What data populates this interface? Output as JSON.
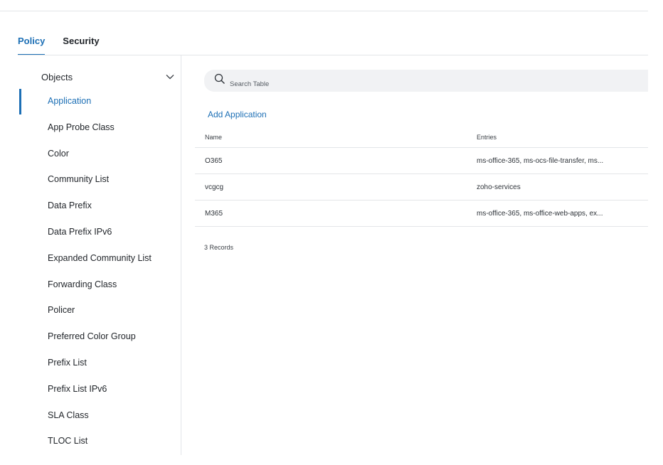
{
  "tabs": [
    {
      "label": "Policy",
      "active": true
    },
    {
      "label": "Security",
      "active": false
    }
  ],
  "sidebar": {
    "group_label": "Objects",
    "group_icon": "chevron-down-icon",
    "items": [
      {
        "label": "Application",
        "active": true
      },
      {
        "label": "App Probe Class"
      },
      {
        "label": "Color"
      },
      {
        "label": "Community List"
      },
      {
        "label": "Data Prefix"
      },
      {
        "label": "Data Prefix IPv6"
      },
      {
        "label": "Expanded Community List"
      },
      {
        "label": "Forwarding Class"
      },
      {
        "label": "Policer"
      },
      {
        "label": "Preferred Color Group"
      },
      {
        "label": "Prefix List"
      },
      {
        "label": "Prefix List IPv6"
      },
      {
        "label": "SLA Class"
      },
      {
        "label": "TLOC List"
      }
    ]
  },
  "search": {
    "placeholder": "Search Table",
    "icon": "search-icon"
  },
  "add_link": "Add Application",
  "table": {
    "columns": [
      "Name",
      "Entries"
    ],
    "rows": [
      {
        "name": "O365",
        "entries": "ms-office-365, ms-ocs-file-transfer, ms..."
      },
      {
        "name": "vcgcg",
        "entries": "zoho-services"
      },
      {
        "name": "M365",
        "entries": "ms-office-365, ms-office-web-apps, ex..."
      }
    ]
  },
  "records": "3 Records",
  "colors": {
    "accent": "#1c6fb5",
    "divider": "#e3e5e8",
    "search_bg": "#f1f2f4"
  }
}
